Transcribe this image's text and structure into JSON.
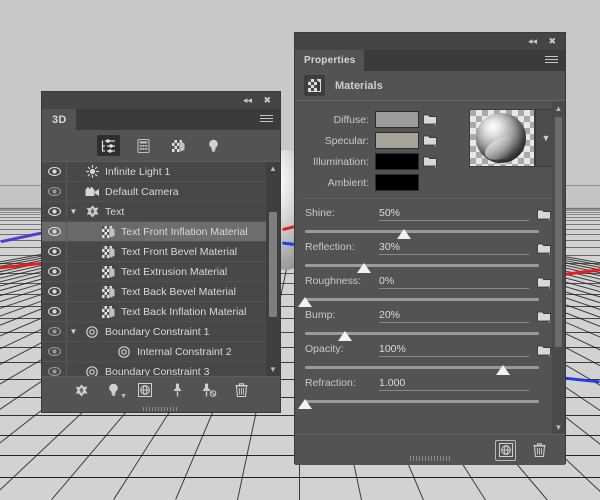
{
  "scene": {
    "axis_colors": {
      "red": "#e02020",
      "blue": "#1f3fe0",
      "purple": "#4a3fd0"
    },
    "ground_color": "#d2d2d2",
    "grid_color": "#161616"
  },
  "panel_3d": {
    "titlebar": {
      "collapse_icon": "double-chevron-left-icon",
      "close_icon": "close-icon"
    },
    "tab_label": "3D",
    "menu_icon": "hamburger-menu-icon",
    "toolbar": [
      {
        "name": "scene-filter-icon",
        "label": "Scene",
        "active": true
      },
      {
        "name": "mesh-filter-icon",
        "label": "Meshes",
        "active": false
      },
      {
        "name": "materials-filter-icon",
        "label": "Materials",
        "active": false
      },
      {
        "name": "lights-filter-icon",
        "label": "Lights",
        "active": false
      }
    ],
    "rows": [
      {
        "label": "Infinite Light 1",
        "icon": "light-icon",
        "indent": 0,
        "twisty": "",
        "selected": false,
        "eye": "eye-icon",
        "eye_on": true
      },
      {
        "label": "Default Camera",
        "icon": "camera-icon",
        "indent": 0,
        "twisty": "",
        "selected": false,
        "eye": "eye-icon",
        "eye_on": false
      },
      {
        "label": "Text",
        "icon": "mesh-icon",
        "indent": 0,
        "twisty": "chevron-down-icon",
        "selected": false,
        "eye": "eye-icon",
        "eye_on": true
      },
      {
        "label": "Text Front Inflation Material",
        "icon": "material-icon",
        "indent": 1,
        "twisty": "",
        "selected": true,
        "eye": "eye-icon",
        "eye_on": true
      },
      {
        "label": "Text Front Bevel Material",
        "icon": "material-icon",
        "indent": 1,
        "twisty": "",
        "selected": false,
        "eye": "eye-icon",
        "eye_on": true
      },
      {
        "label": "Text Extrusion Material",
        "icon": "material-icon",
        "indent": 1,
        "twisty": "",
        "selected": false,
        "eye": "eye-icon",
        "eye_on": true
      },
      {
        "label": "Text Back Bevel Material",
        "icon": "material-icon",
        "indent": 1,
        "twisty": "",
        "selected": false,
        "eye": "eye-icon",
        "eye_on": true
      },
      {
        "label": "Text Back Inflation Material",
        "icon": "material-icon",
        "indent": 1,
        "twisty": "",
        "selected": false,
        "eye": "eye-icon",
        "eye_on": true
      },
      {
        "label": "Boundary Constraint 1",
        "icon": "constraint-icon",
        "indent": 0,
        "twisty": "chevron-down-icon",
        "selected": false,
        "eye": "eye-icon",
        "eye_on": false
      },
      {
        "label": "Internal Constraint 2",
        "icon": "constraint-icon",
        "indent": 2,
        "twisty": "",
        "selected": false,
        "eye": "eye-icon",
        "eye_on": false
      },
      {
        "label": "Boundary Constraint 3",
        "icon": "constraint-icon",
        "indent": 0,
        "twisty": "",
        "selected": false,
        "eye": "eye-icon",
        "eye_on": false
      }
    ],
    "scrollbar": {
      "up_icon": "chevron-up-icon",
      "down_icon": "chevron-down-icon"
    },
    "bottom_toolbar": [
      {
        "name": "add-mesh-button",
        "icon": "mesh-icon"
      },
      {
        "name": "add-light-button",
        "icon": "light-bulb-icon"
      },
      {
        "name": "add-ibl-button",
        "icon": "globe-box-icon"
      },
      {
        "name": "add-constraint-button",
        "icon": "constraint-add-icon"
      },
      {
        "name": "remove-constraint-button",
        "icon": "constraint-remove-icon"
      },
      {
        "name": "delete-button",
        "icon": "trash-icon"
      }
    ]
  },
  "panel_properties": {
    "titlebar": {
      "collapse_icon": "double-chevron-left-icon",
      "close_icon": "close-icon"
    },
    "tab_label": "Properties",
    "menu_icon": "hamburger-menu-icon",
    "header": {
      "icon": "material-icon",
      "title": "Materials"
    },
    "swatches": [
      {
        "label": "Diffuse:",
        "color": "#9b9b9b",
        "folder": "folder-icon"
      },
      {
        "label": "Specular:",
        "color": "#a6a39b",
        "folder": "folder-icon"
      },
      {
        "label": "Illumination:",
        "color": "#000000",
        "folder": "folder-icon"
      },
      {
        "label": "Ambient:",
        "color": "#000000",
        "folder": null
      }
    ],
    "sliders": [
      {
        "label": "Shine:",
        "value": "50%",
        "pct": 50,
        "folder": "folder-icon"
      },
      {
        "label": "Reflection:",
        "value": "30%",
        "pct": 30,
        "folder": "folder-icon"
      },
      {
        "label": "Roughness:",
        "value": "0%",
        "pct": 0,
        "folder": "folder-icon"
      },
      {
        "label": "Bump:",
        "value": "20%",
        "pct": 20,
        "folder": "folder-icon"
      },
      {
        "label": "Opacity:",
        "value": "100%",
        "pct": 100,
        "folder": "folder-icon"
      },
      {
        "label": "Refraction:",
        "value": "1.000",
        "pct": 0,
        "folder": null
      }
    ],
    "preview": {
      "name": "material-sphere-preview",
      "dropdown_icon": "chevron-down-icon"
    },
    "scrollbar": {
      "up_icon": "chevron-up-icon",
      "down_icon": "chevron-down-icon"
    },
    "footer": [
      {
        "name": "load-material-button",
        "icon": "globe-box-icon",
        "boxed": true
      },
      {
        "name": "delete-material-button",
        "icon": "trash-icon",
        "boxed": false
      }
    ]
  }
}
